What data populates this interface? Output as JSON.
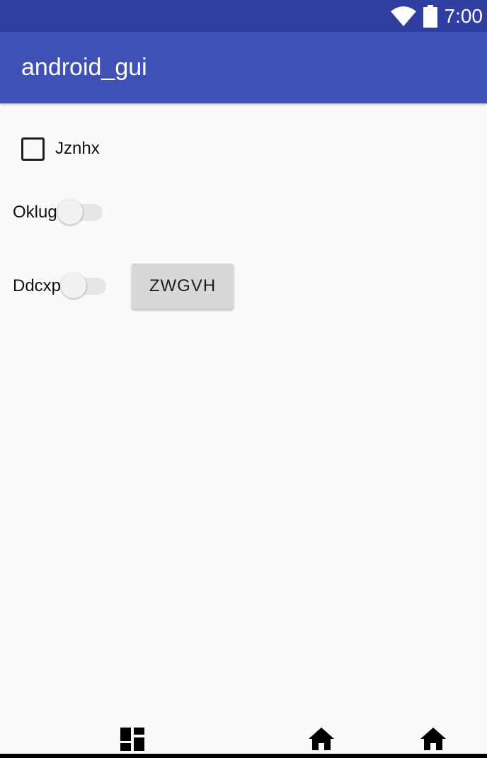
{
  "status_bar": {
    "time": "7:00",
    "icons": [
      "wifi-icon",
      "battery-icon"
    ],
    "color": "#303F9F"
  },
  "app_bar": {
    "title": "android_gui",
    "color": "#3F51B5"
  },
  "checkbox": {
    "label": "Jznhx",
    "checked": false
  },
  "switches": [
    {
      "label": "Oklug",
      "on": false
    },
    {
      "label": "Ddcxp",
      "on": false
    }
  ],
  "button": {
    "label": "ZWGVH"
  },
  "nav_bar": {
    "icons": [
      "dashboard-icon",
      "home-icon",
      "home-icon"
    ]
  }
}
